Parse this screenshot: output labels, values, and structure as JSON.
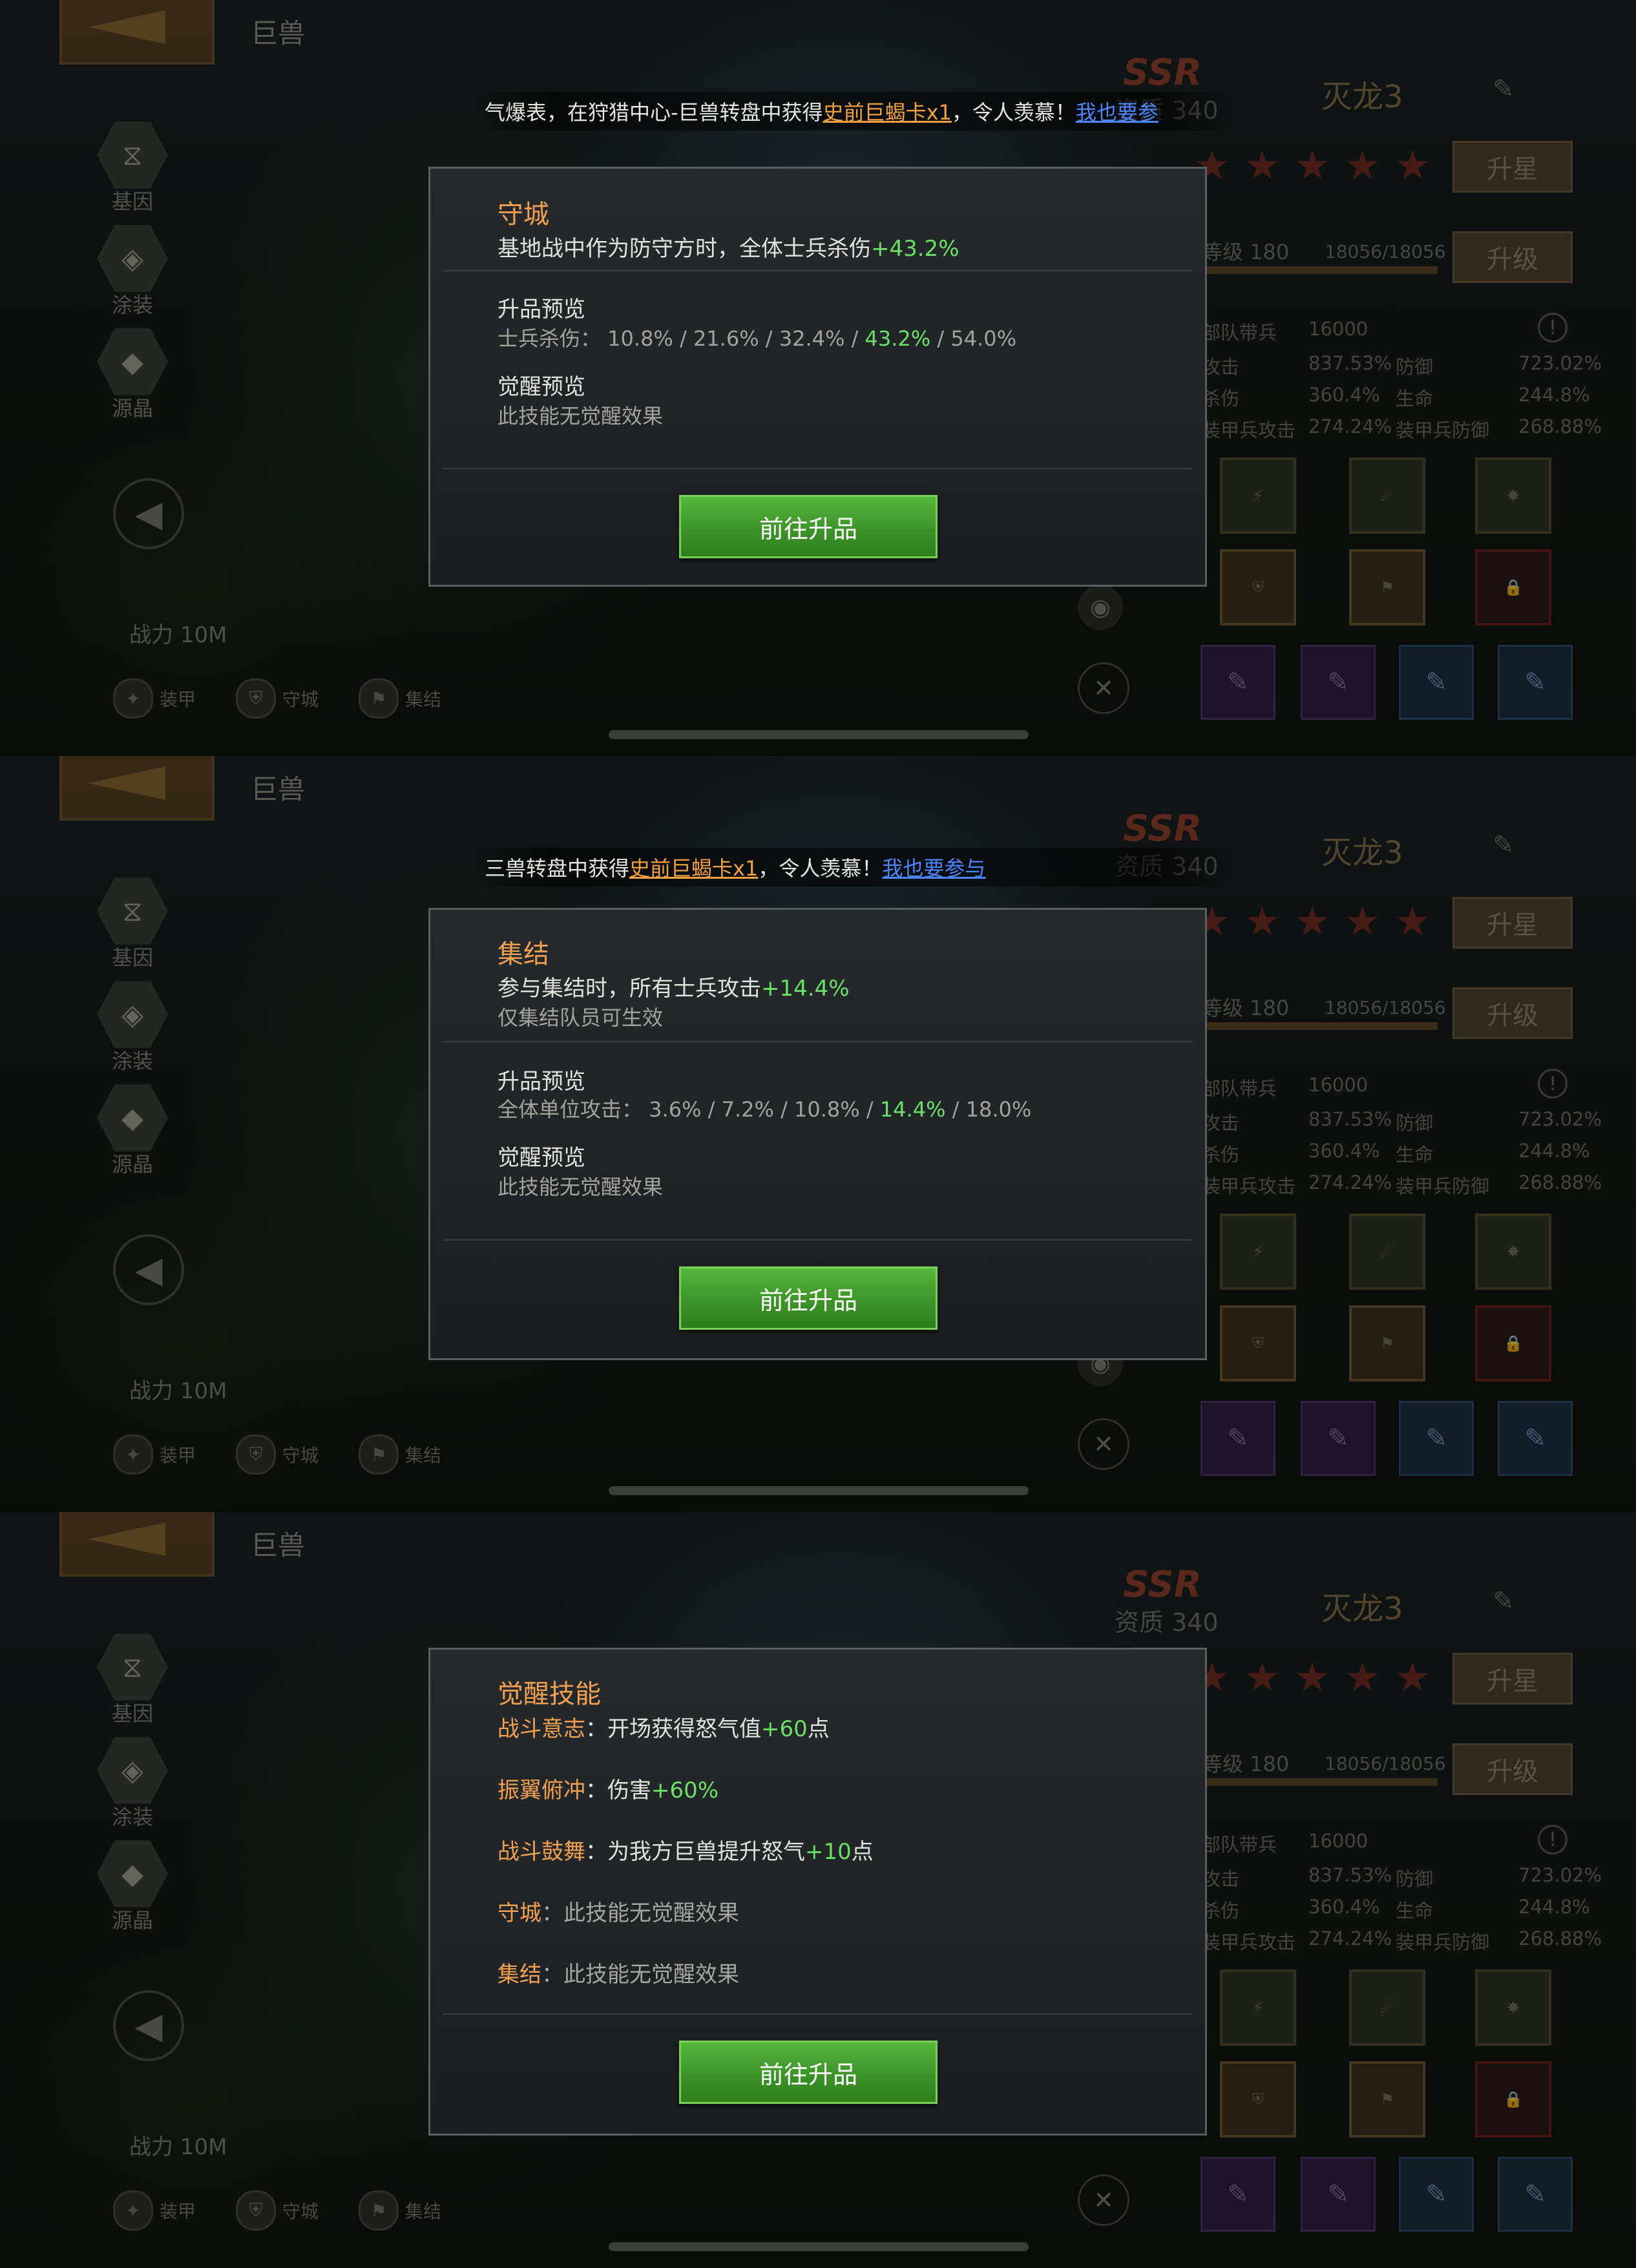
{
  "common": {
    "header_title": "巨兽",
    "side_buttons": [
      "基因",
      "涂装",
      "源晶"
    ],
    "power": "战力 10M",
    "bottom_tags": [
      "装甲",
      "守城",
      "集结"
    ],
    "ssr": "SSR",
    "quality": "资质 340",
    "name": "灭龙3",
    "star_button": "升星",
    "level": "等级 180",
    "exp": "18056/18056",
    "upgrade_button": "升级",
    "troops_label": "部队带兵",
    "troops_value": "16000",
    "stats": [
      [
        "攻击",
        "837.53%",
        "防御",
        "723.02%"
      ],
      [
        "杀伤",
        "360.4%",
        "生命",
        "244.8%"
      ],
      [
        "装甲兵攻击",
        "274.24%",
        "装甲兵防御",
        "268.88%"
      ]
    ],
    "awaken_skill_label": "觉醒技",
    "go_button": "前往升品",
    "star_count": 5,
    "colors": {
      "accent_orange": "#f0a050",
      "highlight_green": "#6be066",
      "link_blue": "#4a86ff",
      "button_green": "#3c9428"
    }
  },
  "screens": [
    {
      "marquee": {
        "prefix": "气爆表，在狩猎中心-巨兽转盘中获得",
        "item": "史前巨蝎卡x1",
        "mid": "，令人羡慕！",
        "link": "我也要参"
      },
      "dialog": {
        "title": "守城",
        "desc_pre": "基地战中作为防守方时，全体士兵杀伤",
        "desc_val": "+43.2%",
        "preview_title": "升品预览",
        "preview_pre": "士兵杀伤： 10.8% / 21.6% / 32.4% / ",
        "preview_val": "43.2%",
        "preview_post": " / 54.0%",
        "awaken_title": "觉醒预览",
        "awaken_text": "此技能无觉醒效果"
      }
    },
    {
      "marquee": {
        "prefix": "三兽转盘中获得",
        "item": "史前巨蝎卡x1",
        "mid": "，令人羡慕！",
        "link": "我也要参与"
      },
      "dialog": {
        "title": "集结",
        "desc_pre": "参与集结时，所有士兵攻击",
        "desc_val": "+14.4%",
        "note": "仅集结队员可生效",
        "preview_title": "升品预览",
        "preview_pre": "全体单位攻击： 3.6% / 7.2% / 10.8% / ",
        "preview_val": "14.4%",
        "preview_post": " / 18.0%",
        "awaken_title": "觉醒预览",
        "awaken_text": "此技能无觉醒效果"
      }
    },
    {
      "dialog": {
        "title": "觉醒技能",
        "skills": [
          {
            "name": "战斗意志",
            "pre": "：开场获得怒气值",
            "val": "+60",
            "post": "点"
          },
          {
            "name": "振翼俯冲",
            "pre": "：伤害",
            "val": "+60%",
            "post": ""
          },
          {
            "name": "战斗鼓舞",
            "pre": "：为我方巨兽提升怒气",
            "val": "+10",
            "post": "点"
          },
          {
            "name": "守城",
            "pre": "：此技能无觉醒效果",
            "val": "",
            "post": ""
          },
          {
            "name": "集结",
            "pre": "：此技能无觉醒效果",
            "val": "",
            "post": ""
          }
        ]
      }
    }
  ]
}
